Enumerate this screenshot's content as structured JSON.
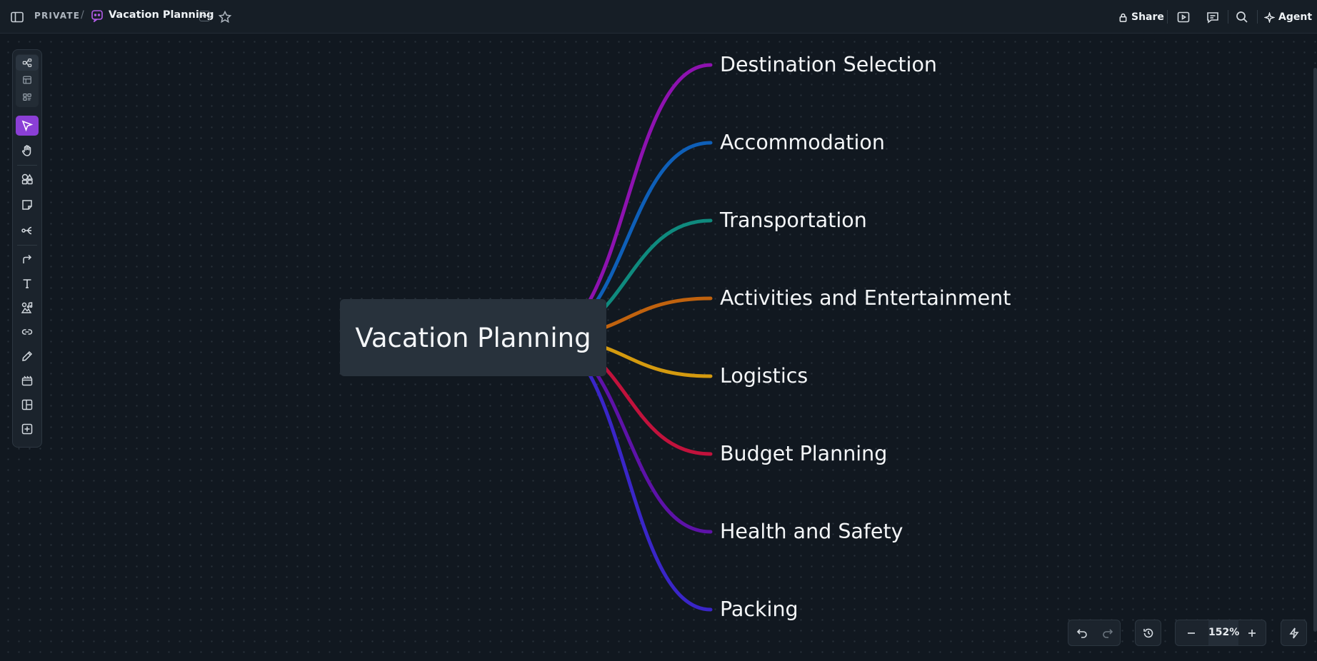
{
  "breadcrumb": {
    "space": "PRIVATE",
    "separator": "/",
    "board_title": "Vacation Planning"
  },
  "header": {
    "share_label": "Share",
    "agent_label": "Agent"
  },
  "mindmap": {
    "root": "Vacation Planning",
    "branches": [
      {
        "label": "Destination Selection",
        "color": "#8e12b0"
      },
      {
        "label": "Accommodation",
        "color": "#0e5fb8"
      },
      {
        "label": "Transportation",
        "color": "#0f8a7e"
      },
      {
        "label": "Activities and Entertainment",
        "color": "#c0620e"
      },
      {
        "label": "Logistics",
        "color": "#d49a0f"
      },
      {
        "label": "Budget Planning",
        "color": "#c1123c"
      },
      {
        "label": "Health and Safety",
        "color": "#5d12a8"
      },
      {
        "label": "Packing",
        "color": "#3a26c8"
      }
    ]
  },
  "zoom": {
    "level": "152%"
  },
  "colors": {
    "accent": "#8b3fd6",
    "background": "#111820",
    "root_node": "#28323c"
  }
}
